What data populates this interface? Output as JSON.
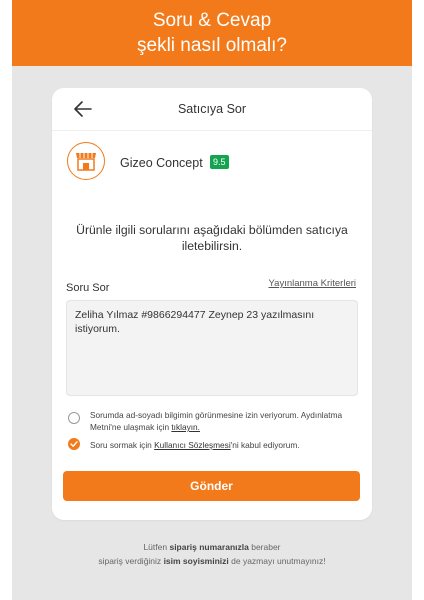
{
  "banner": {
    "line1": "Soru & Cevap",
    "line2": "şekli nasıl olmalı?"
  },
  "dialog": {
    "title": "Satıcıya Sor",
    "seller_name": "Gizeo Concept",
    "seller_score": "9.5",
    "info_line1": "Ürünle ilgili sorularını aşağıdaki bölümden satıcıya",
    "info_line2": "iletebilirsin.",
    "question_label": "Soru Sor",
    "criteria_link": "Yayınlanma Kriterleri",
    "question_value": "Zeliha Yılmaz #9866294477 Zeynep 23 yazılmasını istiyorum.",
    "option1": {
      "checked": false,
      "text1": "Sorumda ad-soyadı bilgimin görünmesine izin veriyorum. Aydınlatma Metni'ne ulaşmak için",
      "link": "tıklayın."
    },
    "option2": {
      "checked": true,
      "text_before": "Soru sormak için",
      "link": "Kullanıcı Sözleşmesi",
      "text_after": "'ni kabul ediyorum."
    },
    "submit_label": "Gönder"
  },
  "footer": {
    "p1": "Lütfen",
    "b1": "sipariş numaranızla",
    "p2": "beraber",
    "p3": "sipariş verdiğiniz",
    "b2": "isim soyisminizi",
    "p4": "de  yazmayı unutmayınız!"
  },
  "colors": {
    "accent": "#f27a1a",
    "score_bg": "#14a34f",
    "backdrop": "#e6e6e6"
  },
  "icons": {
    "back": "arrow-left-icon",
    "store": "store-icon",
    "check": "check-icon"
  }
}
